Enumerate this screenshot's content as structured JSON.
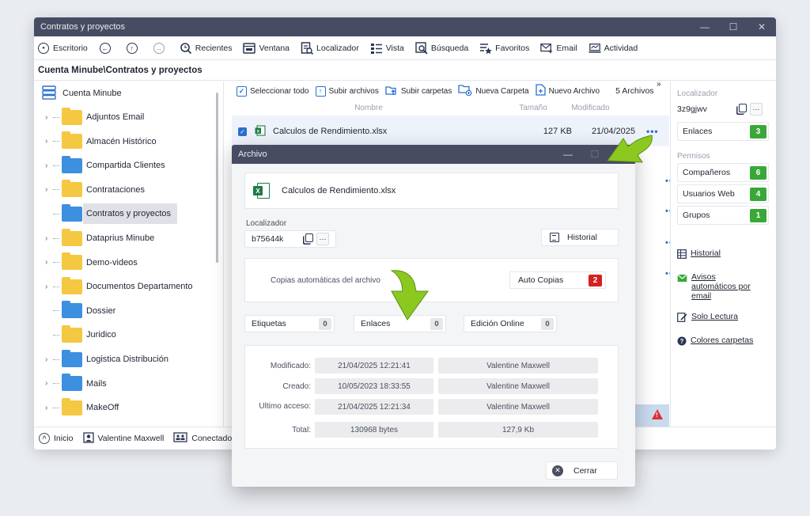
{
  "window": {
    "title": "Contratos y proyectos",
    "controls": [
      "—",
      "☐",
      "✕"
    ]
  },
  "toolbar": [
    {
      "id": "escritorio",
      "label": "Escritorio",
      "icon": "desktop-icon"
    },
    {
      "id": "back",
      "label": "",
      "icon": "back-arrow-icon"
    },
    {
      "id": "up",
      "label": "",
      "icon": "up-arrow-icon"
    },
    {
      "id": "forward",
      "label": "",
      "icon": "forward-arrow-icon"
    },
    {
      "id": "recientes",
      "label": "Recientes",
      "icon": "recent-search-icon"
    },
    {
      "id": "ventana",
      "label": "Ventana",
      "icon": "window-icon"
    },
    {
      "id": "localizador",
      "label": "Localizador",
      "icon": "locator-icon"
    },
    {
      "id": "vista",
      "label": "Vista",
      "icon": "view-list-icon"
    },
    {
      "id": "busqueda",
      "label": "Búsqueda",
      "icon": "search-icon"
    },
    {
      "id": "favoritos",
      "label": "Favoritos",
      "icon": "favorites-icon"
    },
    {
      "id": "email",
      "label": "Email",
      "icon": "email-icon"
    },
    {
      "id": "actividad",
      "label": "Actividad",
      "icon": "activity-icon"
    }
  ],
  "path": "Cuenta Minube\\Contratos y proyectos",
  "tree": {
    "root": "Cuenta Minube",
    "items": [
      {
        "label": "Adjuntos Email",
        "color": "yellow",
        "expandable": true
      },
      {
        "label": "Almacén Histórico",
        "color": "yellow",
        "expandable": true
      },
      {
        "label": "Compartida Clientes",
        "color": "blue",
        "expandable": true
      },
      {
        "label": "Contrataciones",
        "color": "yellow",
        "expandable": true
      },
      {
        "label": "Contratos y proyectos",
        "color": "blue",
        "expandable": false,
        "selected": true
      },
      {
        "label": "Dataprius Minube",
        "color": "yellow",
        "expandable": true
      },
      {
        "label": "Demo-videos",
        "color": "yellow",
        "expandable": true
      },
      {
        "label": "Documentos Departamento",
        "color": "yellow",
        "expandable": true
      },
      {
        "label": "Dossier",
        "color": "blue",
        "expandable": false
      },
      {
        "label": "Juridico",
        "color": "yellow",
        "expandable": false
      },
      {
        "label": "Logistica Distribución",
        "color": "blue",
        "expandable": true
      },
      {
        "label": "Mails",
        "color": "blue",
        "expandable": true
      },
      {
        "label": "MakeOff",
        "color": "yellow",
        "expandable": true
      }
    ]
  },
  "status": {
    "inicio": "Inicio",
    "user": "Valentine Maxwell",
    "conectados": "Conectados"
  },
  "files": {
    "select_all": "Seleccionar todo",
    "upload_files": "Subir archivos",
    "upload_folders": "Subir carpetas",
    "new_folder": "Nueva Carpeta",
    "new_file": "Nuevo Archivo",
    "count": "5 Archivos",
    "more": "»",
    "col_name": "Nombre",
    "col_size": "Tamaño",
    "col_modified": "Modificado",
    "rows": [
      {
        "name": "Calculos de Rendimiento.xlsx",
        "size": "127 KB",
        "modified": "21/04/2025",
        "checked": true
      }
    ]
  },
  "right_panel": {
    "localizador_label": "Localizador",
    "localizador_value": "3z9gjwv",
    "enlaces_label": "Enlaces",
    "enlaces_count": "3",
    "permisos_label": "Permisos",
    "companeros_label": "Compañeros",
    "companeros_count": "6",
    "usuarios_web_label": "Usuarios Web",
    "usuarios_web_count": "4",
    "grupos_label": "Grupos",
    "grupos_count": "1",
    "links": {
      "historial": "Historial",
      "avisos": "Avisos automáticos por email",
      "solo_lectura": "Solo Lectura",
      "colores": "Colores carpetas"
    }
  },
  "dialog": {
    "title": "Archivo",
    "file_name": "Calculos de Rendimiento.xlsx",
    "localizador_label": "Localizador",
    "localizador_value": "b75644k",
    "historial_button": "Historial",
    "copias_label": "Copias automáticas del archivo",
    "auto_copias_label": "Auto Copias",
    "auto_copias_count": "2",
    "etiquetas_label": "Etiquetas",
    "etiquetas_count": "0",
    "enlaces_label": "Enlaces",
    "enlaces_count": "0",
    "edicion_label": "Edición Online",
    "edicion_count": "0",
    "modificado_label": "Modificado:",
    "modificado_date": "21/04/2025 12:21:41",
    "modificado_user": "Valentine Maxwell",
    "creado_label": "Creado:",
    "creado_date": "10/05/2023 18:33:55",
    "creado_user": "Valentine Maxwell",
    "ultimo_label": "Ultimo acceso:",
    "ultimo_date": "21/04/2025 12:21:34",
    "ultimo_user": "Valentine Maxwell",
    "total_label": "Total:",
    "total_bytes": "130968 bytes",
    "total_kb": "127,9 Kb",
    "close_button": "Cerrar"
  },
  "colors": {
    "titlebar": "#474c63",
    "accent": "#2a6fd0",
    "badge_green": "#3aa838",
    "badge_red": "#d42020",
    "folder_yellow": "#f5c842",
    "folder_blue": "#3d8fe0",
    "callout_arrow": "#8cc920"
  }
}
